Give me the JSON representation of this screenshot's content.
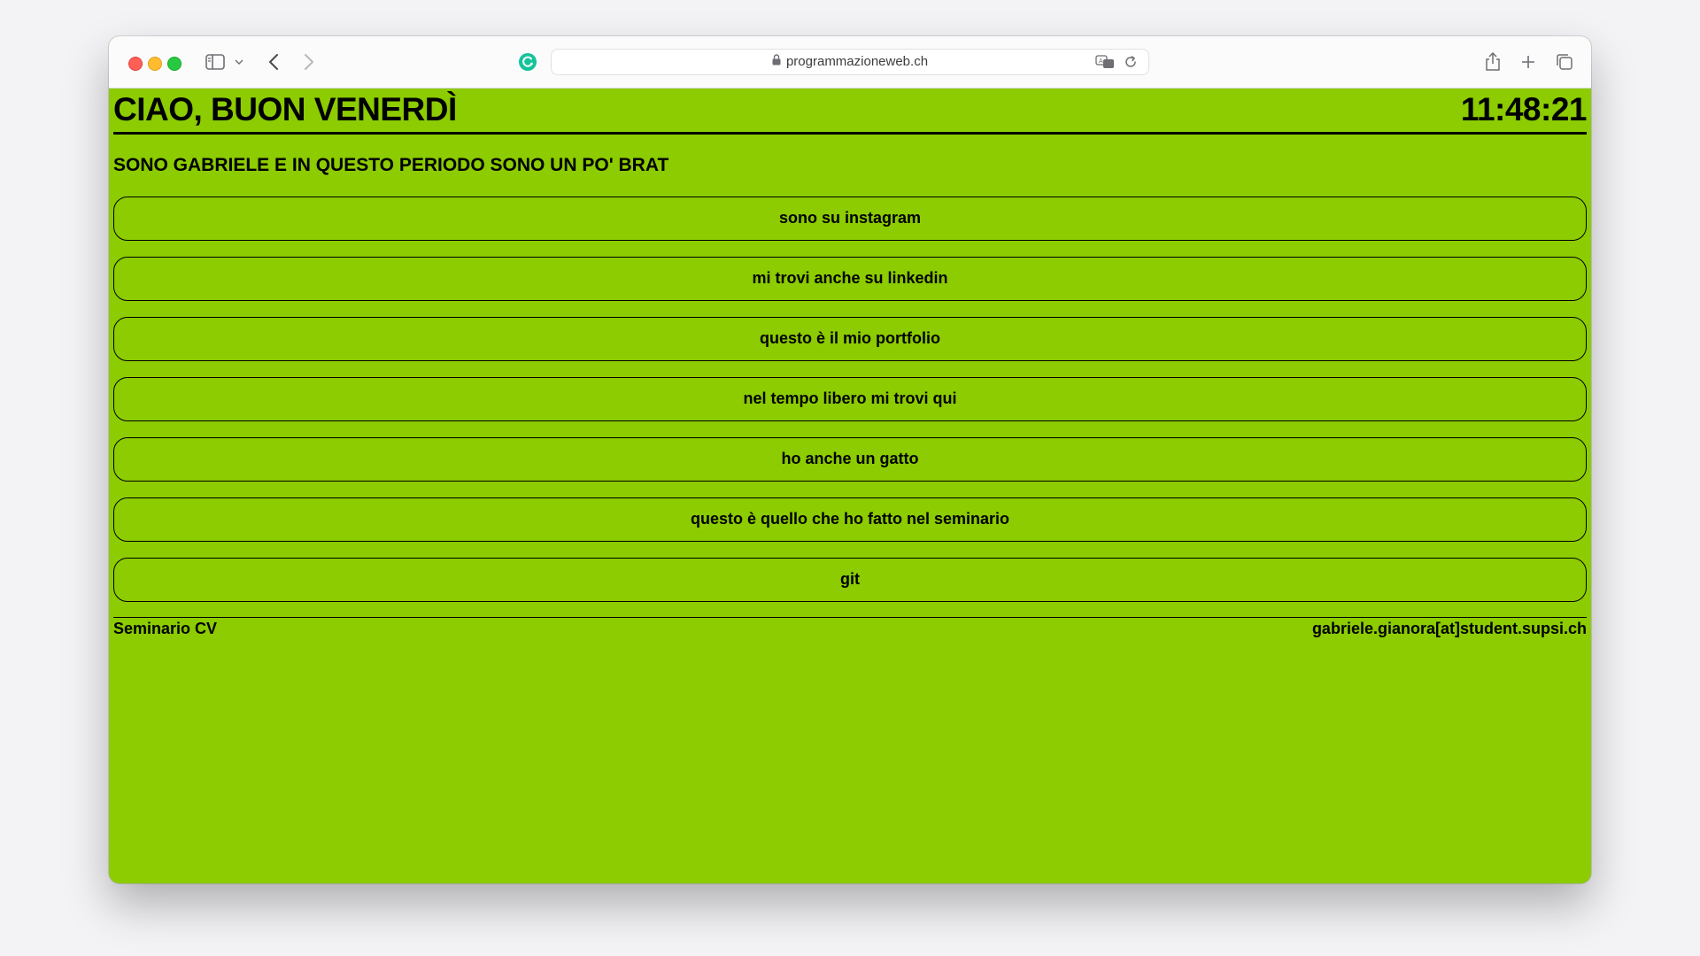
{
  "browser": {
    "url": "programmazioneweb.ch",
    "icons": [
      "close-window-button",
      "minimize-window-button",
      "zoom-window-button",
      "sidebar-icon",
      "chevron-down-icon",
      "back-arrow-icon",
      "forward-arrow-icon",
      "extension-icon",
      "lock-icon",
      "translate-icon",
      "reload-icon",
      "share-icon",
      "new-tab-icon",
      "tab-overview-icon"
    ]
  },
  "page": {
    "greeting": "CIAO, BUON VENERDÌ",
    "clock": "11:48:21",
    "subtitle": "SONO GABRIELE E IN QUESTO PERIODO SONO UN PO' BRAT",
    "links": [
      "sono su instagram",
      "mi trovi anche su linkedin",
      "questo è il mio portfolio",
      "nel tempo libero mi trovi qui",
      "ho anche un gatto",
      "questo è quello che ho fatto nel seminario",
      "git"
    ],
    "footer": {
      "left": "Seminario CV",
      "right": "gabriele.gianora[at]student.supsi.ch"
    }
  },
  "colors": {
    "page_background": "#8ccc00",
    "text": "#000000",
    "desktop_background": "#f3f3f6"
  }
}
